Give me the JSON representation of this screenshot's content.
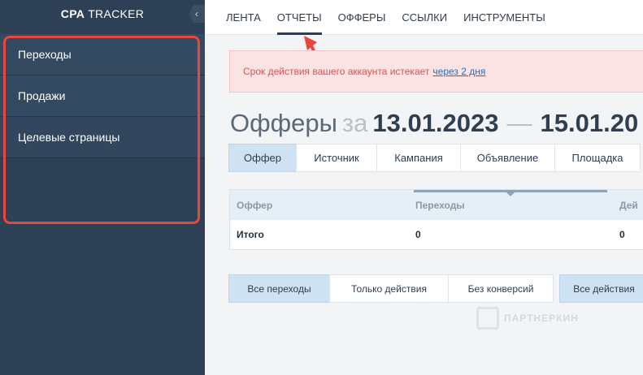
{
  "brand": {
    "bold": "CPA",
    "rest": "TRACKER",
    "collapse_icon": "‹"
  },
  "sidebar": {
    "items": [
      {
        "label": "Переходы"
      },
      {
        "label": "Продажи"
      },
      {
        "label": "Целевые страницы"
      }
    ]
  },
  "topnav": {
    "items": [
      {
        "label": "ЛЕНТА"
      },
      {
        "label": "ОТЧЕТЫ",
        "active": true
      },
      {
        "label": "ОФФЕРЫ"
      },
      {
        "label": "ССЫЛКИ"
      },
      {
        "label": "ИНСТРУМЕНТЫ"
      }
    ]
  },
  "alert": {
    "text": "Срок действия вашего аккаунта истекает",
    "link": "через 2 дня"
  },
  "title": {
    "main": "Офферы",
    "za": "за",
    "date_from": "13.01.2023",
    "dash": "—",
    "date_to": "15.01.20"
  },
  "groups": [
    {
      "label": "Оффер",
      "active": true
    },
    {
      "label": "Источник"
    },
    {
      "label": "Кампания"
    },
    {
      "label": "Объявление"
    },
    {
      "label": "Площадка"
    }
  ],
  "table": {
    "headers": [
      "Оффер",
      "Переходы",
      "Дей"
    ],
    "rows": [
      [
        "Итого",
        "0",
        "0"
      ]
    ]
  },
  "filters": [
    {
      "label": "Все переходы",
      "active": true
    },
    {
      "label": "Только действия"
    },
    {
      "label": "Без конверсий"
    },
    {
      "label": "Все действия",
      "active": true
    }
  ],
  "watermark": {
    "text": "ПАРТНЕРКИН"
  },
  "colors": {
    "sidebar_bg": "#2e4055",
    "highlight": "#e8473e",
    "active_tab": "#cfe2f3",
    "alert_bg": "#fbe3e4",
    "alert_text": "#d9534f",
    "link": "#2a6db3"
  }
}
